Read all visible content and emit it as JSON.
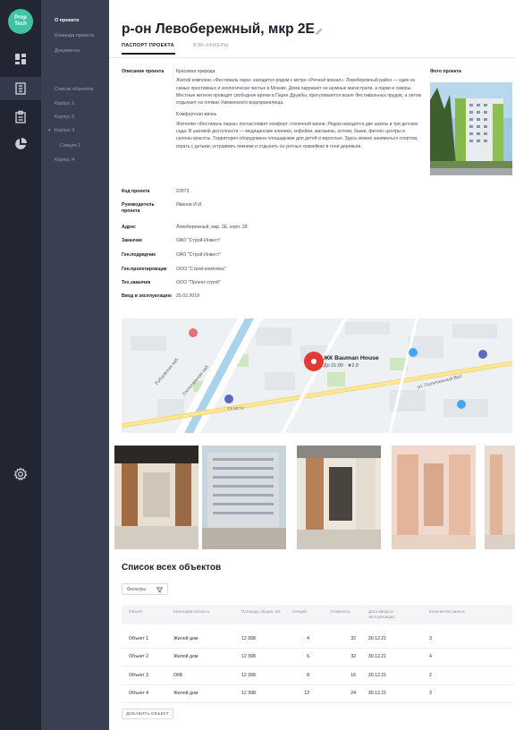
{
  "app": {
    "logo_text": "Prop Tech",
    "icons": [
      "dashboard-icon",
      "building-icon",
      "clipboard-icon",
      "pie-chart-icon",
      "settings-icon"
    ]
  },
  "sidebar": {
    "items": [
      {
        "label": "О проекте",
        "active": true
      },
      {
        "label": "Команда проекта",
        "active": false
      },
      {
        "label": "Документы",
        "active": false
      },
      {
        "label": "Список объектов",
        "active": false
      },
      {
        "label": "Корпус 1",
        "active": false
      },
      {
        "label": "Корпус 2",
        "active": false
      },
      {
        "label": "Корпус 3",
        "active": false
      },
      {
        "label": "Секция 1",
        "active": false
      },
      {
        "label": "Корпус 4",
        "active": false
      }
    ]
  },
  "header": {
    "title": "р-он Левобережный, мкр 2Е",
    "tabs": [
      {
        "label": "ПАСПОРТ ПРОЕКТА",
        "active": true
      },
      {
        "label": "ВЭБ-КАМЕРЫ",
        "active": false
      }
    ]
  },
  "passport": {
    "description_label": "Описание проекта",
    "description": [
      "Красивая природа",
      "Жилой комплекс «Фестиваль парк» находится рядом с метро «Речной вокзал». Левобережный район — один из самых престижных и экологически чистых в Москве. Дома окружают не шумные магистрали, а парки и скверы. Местные жители проводят свободное время в Парке Дружбы, прогуливаются возле Фестивальных прудов, а летом отдыхают на пляжах Химкинского водохранилища.",
      "Комфортная жизнь",
      "Жителям «Фестиваль парка» посчастливит комфорт столичной жизни. Рядом находятся две школы и три детских сада. В шаговой доступности — медицинские клиники, кофейни, магазины, аптеки, банки, фитнес центры и салоны красоты. Территория оборудована площадками для детей и взрослых. Здесь можно заниматься спортом, играть с детьми, устраивать пикники и отдыхать на уютных скамейках в тени деревьев."
    ],
    "photo_label": "Фото проекта",
    "fields": [
      {
        "label": "Код проекта",
        "value": "22873"
      },
      {
        "label": "Руководитель проекта",
        "value": "Иванов И.И."
      },
      {
        "label": "Адрес",
        "value": "Левобережный, мкр. 2Е, корп. 28"
      },
      {
        "label": "Заказчик",
        "value": "ОАО \"Строй-Инвест\""
      },
      {
        "label": "Ген.подрядчик",
        "value": "ОАО \"Строй-Инвест\""
      },
      {
        "label": "Ген.проектировщик",
        "value": "ООО \"Строй-комплекс\""
      },
      {
        "label": "Тех.заказчик",
        "value": "ООО \"Проект-строй\""
      },
      {
        "label": "Ввод в эксплуатацию",
        "value": "25.02.2019"
      }
    ]
  },
  "map": {
    "place_name": "ЖК Bauman House",
    "place_sub": "До 21:00 · ★2,9",
    "street_1": "Рубцовская наб.",
    "street_2": "Госпитальная наб.",
    "street_3": "ул. Госпитальный Вал",
    "poi": "СК МГТУ"
  },
  "objects": {
    "title": "Список всех объектов",
    "filter_label": "Фильтры",
    "columns": [
      "Объект",
      "Категория объекта",
      "Площадь общая, м2",
      "Секций",
      "Этажность",
      "Дата ввода в эксплуатацию",
      "Количество жилых"
    ],
    "rows": [
      [
        "Объект 1",
        "Жилой дом",
        "12 398",
        "4",
        "32",
        "30.12.21",
        "3"
      ],
      [
        "Объект 2",
        "Жилой дом",
        "12 398",
        "6",
        "32",
        "30.12.21",
        "4"
      ],
      [
        "Объект 3",
        "ОКБ",
        "12 398",
        "8",
        "16",
        "30.12.21",
        "2"
      ],
      [
        "Объект 4",
        "Жилой дом",
        "12 398",
        "12",
        "24",
        "30.12.21",
        "3"
      ]
    ],
    "add_label": "ДОБАВИТЬ ОБЪЕКТ"
  },
  "colors": {
    "rail": "#222633",
    "sidebar": "#3a3f52",
    "brand": "#3ec4a2",
    "map_pin": "#e53935"
  }
}
